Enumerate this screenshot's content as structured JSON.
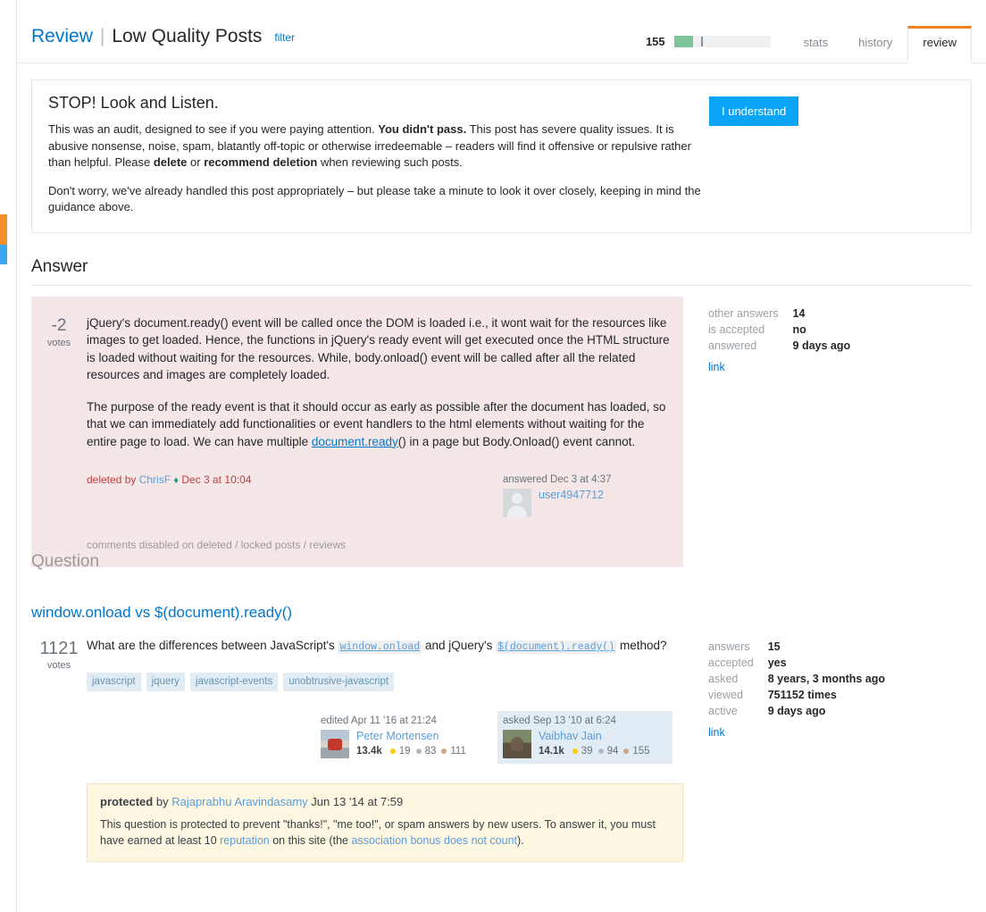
{
  "header": {
    "review_link": "Review",
    "separator": "|",
    "queue_name": "Low Quality Posts",
    "filter_label": "filter",
    "progress_count": "155",
    "progress_fill_percent": 20,
    "progress_tick_percent": 28,
    "progress_fill_color": "#7ec699",
    "tabs": [
      {
        "label": "stats",
        "selected": false
      },
      {
        "label": "history",
        "selected": false
      },
      {
        "label": "review",
        "selected": true
      }
    ],
    "accent_color": "#f48024"
  },
  "notice": {
    "title": "STOP! Look and Listen.",
    "para1_a": "This was an audit, designed to see if you were paying attention. ",
    "para1_b": "You didn't pass.",
    "para1_c": " This post has severe quality issues. It is abusive nonsense, noise, spam, blatantly off-topic or otherwise irredeemable – readers will find it offensive or repulsive rather than helpful. Please ",
    "para1_d": "delete",
    "para1_e": " or ",
    "para1_f": "recommend deletion",
    "para1_g": " when reviewing such posts.",
    "para2": "Don't worry, we've already handled this post appropriately – but please take a minute to look it over closely, keeping in mind the guidance above.",
    "button_label": "I understand",
    "button_color": "#0ba5f7"
  },
  "answer_section": {
    "heading": "Answer",
    "votes": "-2",
    "votes_label": "votes",
    "body_p1_a": "jQuery's document.ready() event will be called once the DOM is loaded i.e., it wont wait for the resources like images to get loaded. Hence, the functions in jQuery's ready event will get executed once the HTML structure is loaded without waiting for the resources. While, body.onload() event will be called after all the related resources and images are completely loaded.",
    "body_p2_a": "The purpose of the ready event is that it should occur as early as possible after the document has loaded, so that we can immediately add functionalities or event handlers to the html elements without waiting for the entire page to load. We can have multiple ",
    "body_p2_link": "document.ready",
    "body_p2_b": "() in a page but Body.Onload() event cannot.",
    "stats": [
      {
        "key": "other answers",
        "value": "14"
      },
      {
        "key": "is accepted",
        "value": "no"
      },
      {
        "key": "answered",
        "value": "9 days ago"
      }
    ],
    "link_label": "link",
    "deleted_prefix": "deleted by ",
    "deleted_user": "ChrisF",
    "deleted_diamond": "♦",
    "deleted_date": " Dec 3 at 10:04",
    "answered_action": "answered Dec 3 at 4:37",
    "answered_user": "user4947712",
    "comments_disabled": "comments disabled on deleted / locked posts / reviews"
  },
  "question_section": {
    "heading": "Question",
    "title": "window.onload vs $(document).ready()",
    "votes": "1121",
    "votes_label": "votes",
    "body_a": "What are the differences between JavaScript's ",
    "body_code1": "window.onload",
    "body_b": " and jQuery's ",
    "body_code2": "$(document).ready()",
    "body_c": " method?",
    "tags": [
      "javascript",
      "jquery",
      "javascript-events",
      "unobtrusive-javascript"
    ],
    "stats": [
      {
        "key": "answers",
        "value": "15"
      },
      {
        "key": "accepted",
        "value": "yes"
      },
      {
        "key": "asked",
        "value": "8 years, 3 months ago"
      },
      {
        "key": "viewed",
        "value": "751152 times"
      },
      {
        "key": "active",
        "value": "9 days ago"
      }
    ],
    "link_label": "link",
    "editor": {
      "action": "edited Apr 11 '16 at 21:24",
      "name": "Peter Mortensen",
      "rep": "13.4k",
      "gold": "19",
      "silver": "83",
      "bronze": "111"
    },
    "asker": {
      "action": "asked Sep 13 '10 at 6:24",
      "name": "Vaibhav Jain",
      "rep": "14.1k",
      "gold": "39",
      "silver": "94",
      "bronze": "155"
    }
  },
  "protected_notice": {
    "label": "protected",
    "by": " by ",
    "user": "Rajaprabhu Aravindasamy",
    "date": " Jun 13 '14 at 7:59",
    "body_a": "This question is protected to prevent \"thanks!\", \"me too!\", or spam answers by new users. To answer it, you must have earned at least 10 ",
    "body_link1": "reputation",
    "body_b": " on this site (the ",
    "body_link2": "association bonus does not count",
    "body_c": ")."
  }
}
